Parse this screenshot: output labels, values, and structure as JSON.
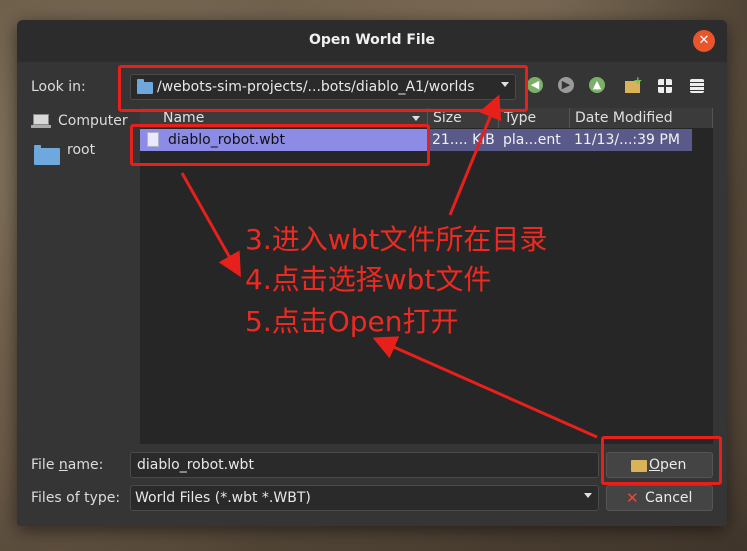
{
  "window": {
    "title": "Open World File",
    "close_icon": "close-icon"
  },
  "look_in": {
    "label": "Look in:",
    "path": "/webots-sim-projects/...bots/diablo_A1/worlds"
  },
  "sidebar": {
    "items": [
      {
        "label": "Computer",
        "icon": "computer-icon"
      },
      {
        "label": "root",
        "icon": "folder-icon"
      }
    ]
  },
  "file_list": {
    "columns": [
      "Name",
      "Size",
      "Type",
      "Date Modified"
    ],
    "rows": [
      {
        "name": "diablo_robot.wbt",
        "size": "21.... KiB",
        "type": "pla...ent",
        "date": "11/13/...:39 PM"
      }
    ]
  },
  "file_name": {
    "label_pre": "File ",
    "label_u": "n",
    "label_post": "ame:",
    "value": "diablo_robot.wbt"
  },
  "file_type": {
    "label": "Files of type:",
    "value": "World Files (*.wbt *.WBT)"
  },
  "buttons": {
    "open_u": "O",
    "open_rest": "pen",
    "cancel": "Cancel"
  },
  "annotations": {
    "step3": "3.进入wbt文件所在目录",
    "step4": "4.点击选择wbt文件",
    "step5": "5.点击Open打开",
    "color": "#e8201c"
  }
}
